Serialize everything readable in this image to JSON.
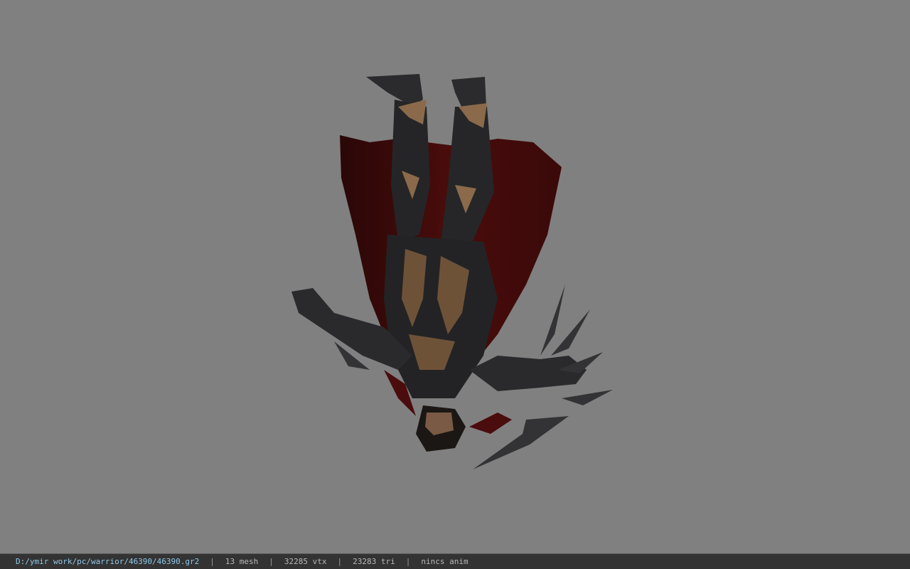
{
  "viewer": {
    "background_color": "#808080",
    "model_name": "warrior armor model (upside down)"
  },
  "status": {
    "file_path": "D:/ymir work/pc/warrior/46390/46390.gr2",
    "mesh_count": "13 mesh",
    "vertex_count": "32285 vtx",
    "triangle_count": "23283 tri",
    "anim_status": "nincs anim",
    "separator": "|"
  }
}
